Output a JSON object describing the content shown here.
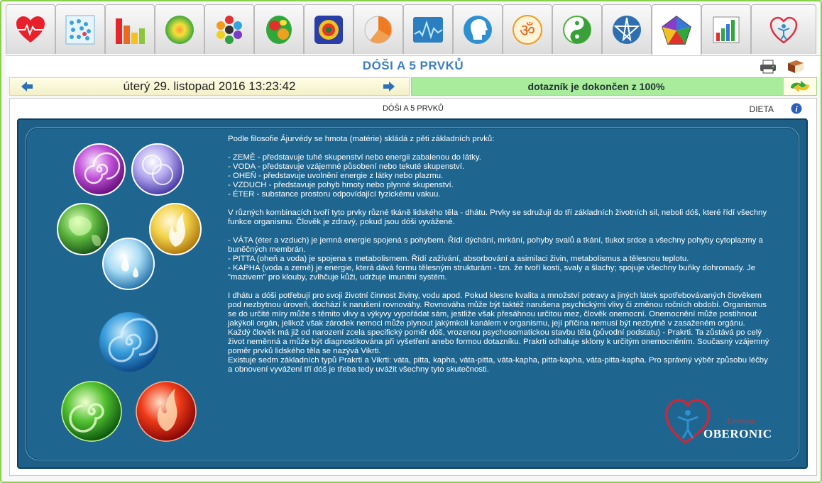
{
  "tabs": [
    {
      "id": "heart",
      "icon": "heart-pulse-icon"
    },
    {
      "id": "grid",
      "icon": "dot-grid-icon"
    },
    {
      "id": "bars",
      "icon": "bar-chart-icon"
    },
    {
      "id": "sphere",
      "icon": "green-sphere-icon"
    },
    {
      "id": "hex",
      "icon": "hexagon-cluster-icon"
    },
    {
      "id": "brain",
      "icon": "brain-map-icon"
    },
    {
      "id": "mandala",
      "icon": "mandala-icon"
    },
    {
      "id": "pie",
      "icon": "pie-chart-icon"
    },
    {
      "id": "wave",
      "icon": "wave-monitor-icon"
    },
    {
      "id": "head",
      "icon": "head-profile-icon"
    },
    {
      "id": "om",
      "icon": "om-symbol-icon"
    },
    {
      "id": "yinyang",
      "icon": "yin-yang-icon"
    },
    {
      "id": "star",
      "icon": "pentagram-icon"
    },
    {
      "id": "pentagon",
      "icon": "pentagon-chart-icon",
      "active": true
    },
    {
      "id": "barchart2",
      "icon": "bar-chart-color-icon"
    },
    {
      "id": "logo",
      "icon": "heart-figure-logo-icon"
    }
  ],
  "header": {
    "title": "DÓŠI A 5 PRVKŮ"
  },
  "nav": {
    "datetime": "úterý 29. listopad 2016 13:23:42",
    "status": "dotazník je dokončen z 100%"
  },
  "content": {
    "subtitle": "DÓŠI A 5 PRVKŮ",
    "dieta": "DIETA",
    "paragraphs": [
      [
        "Podle filosofie Ájurvédy se hmota (matérie) skládá z pěti základních prvků:"
      ],
      [
        "- ZEMĚ - představuje tuhé skupenství nebo energii zabalenou do látky.",
        "- VODA - představuje vzájemné působení nebo tekuté skupenství.",
        "- OHEŇ - představuje uvolnění energie z látky nebo plazmu.",
        "- VZDUCH - představuje pohyb hmoty nebo plynné skupenství.",
        "- ÉTER - substance prostoru odpovídající fyzickému vakuu."
      ],
      [
        "V různých kombinacích tvoří tyto prvky různé tkáně lidského těla - dhátu. Prvky se sdružují do tří základních životních sil, neboli dóš, které řídí všechny",
        "funkce organismu. Člověk je zdravý, pokud jsou dóši vyvážené."
      ],
      [
        "- VÁTA (éter a vzduch) je jemná energie spojená s pohybem. Řídí dýchání, mrkání, pohyby svalů a tkání, tlukot srdce a všechny pohyby cytoplazmy a",
        "buněčných membrán.",
        "- PITTA (oheň a voda) je spojena s metabolismem. Řídí zažívání, absorbování a asimilaci živin, metabolismus a tělesnou teplotu.",
        "- KAPHA (voda a země) je energie, která dává formu tělesným strukturám - tzn. že tvoří kosti, svaly a šlachy; spojuje všechny buňky dohromady. Je",
        "\"mazivem\" pro klouby, zvlhčuje kůži, udržuje imunitní systém."
      ],
      [
        "I dhátu a dóši potřebují pro svoji životní činnost živiny, vodu apod. Pokud klesne kvalita a množství potravy a jiných látek spotřebovávaných člověkem",
        "pod nezbytnou úroveň, dochází k narušení rovnováhy. Rovnováha může být taktéž narušena psychickými vlivy či změnou ročních období. Organismus",
        "se do určité míry může s těmito vlivy a výkyvy vypořádat sám, jestliže však přesáhnou určitou mez, člověk onemocní. Onemocnění může postihnout",
        "jakýkoli orgán, jelikož však zárodek nemoci může plynout jakýmkoli kanálem v organismu, její příčina nemusí být nezbytně v zasaženém orgánu.",
        "Každý člověk má již od narození zcela specifický poměr dóš, vrozenou psychosomatickou stavbu těla (původní podstatu) - Prakrti. Ta zůstává po celý",
        "život neměnná a může být diagnostikována při vyšetření anebo formou dotazníku. Prakrti odhaluje sklony k určitým onemocněním. Současný vzájemný",
        "poměr prvků lidského těla se nazývá Vikrti.",
        "Existuje sedm základních typů Prakrti a Vikrti: váta, pitta, kapha, váta-pitta, váta-kapha, pitta-kapha, váta-pitta-kapha. Pro správný výběr způsobu léčby",
        "a obnovení vyvážení tří dóš je třeba tedy uvážit všechny tyto skutečnosti."
      ]
    ],
    "logo": {
      "small": "Centrum",
      "big": "OBERONIC"
    }
  },
  "colors": {
    "title_blue": "#3d7ec0",
    "status_green": "#a8ec9c",
    "panel_blue": "#1e6690",
    "frame_green": "#8ad04a"
  }
}
